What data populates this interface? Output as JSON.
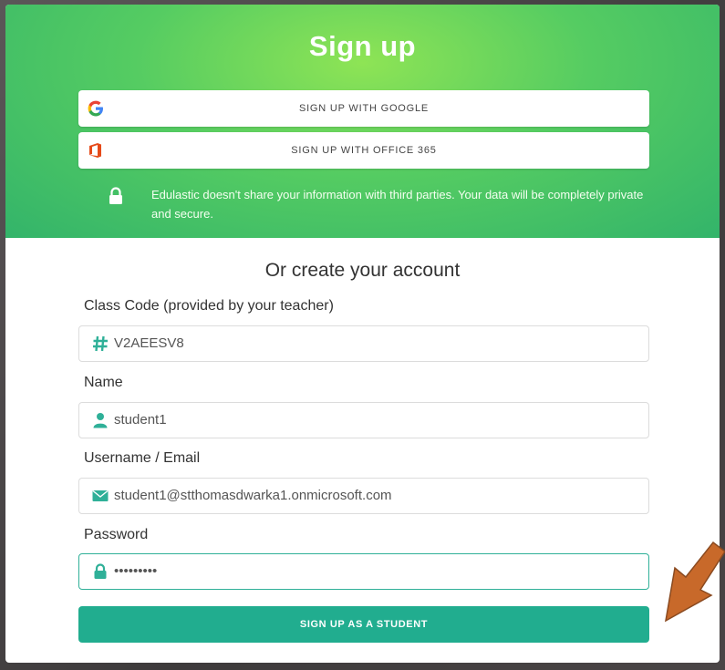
{
  "header": {
    "title": "Sign up",
    "google_button": "SIGN UP WITH GOOGLE",
    "office_button": "SIGN UP WITH OFFICE 365",
    "privacy_text": "Edulastic doesn't share your information with third parties. Your data will be completely private and secure."
  },
  "form": {
    "subheading": "Or create your account",
    "class_code": {
      "label": "Class Code (provided by your teacher)",
      "value": "V2AEESV8",
      "icon": "hash-icon"
    },
    "name": {
      "label": "Name",
      "value": "student1",
      "icon": "user-icon"
    },
    "username": {
      "label": "Username / Email",
      "value": "student1@stthomasdwarka1.onmicrosoft.com",
      "icon": "envelope-icon"
    },
    "password": {
      "label": "Password",
      "value": "•••••••••",
      "icon": "lock-icon"
    },
    "submit_label": "SIGN UP AS A STUDENT"
  },
  "colors": {
    "header_green": "#55cc62",
    "accent_teal": "#21ad8f",
    "annotation_arrow": "#c8692a"
  }
}
